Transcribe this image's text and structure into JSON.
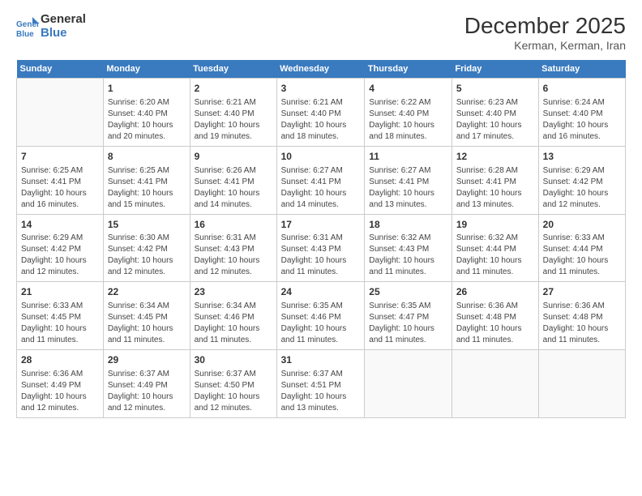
{
  "header": {
    "logo_line1": "General",
    "logo_line2": "Blue",
    "title": "December 2025",
    "subtitle": "Kerman, Kerman, Iran"
  },
  "days_of_week": [
    "Sunday",
    "Monday",
    "Tuesday",
    "Wednesday",
    "Thursday",
    "Friday",
    "Saturday"
  ],
  "weeks": [
    [
      {
        "day": "",
        "info": ""
      },
      {
        "day": "1",
        "info": "Sunrise: 6:20 AM\nSunset: 4:40 PM\nDaylight: 10 hours\nand 20 minutes."
      },
      {
        "day": "2",
        "info": "Sunrise: 6:21 AM\nSunset: 4:40 PM\nDaylight: 10 hours\nand 19 minutes."
      },
      {
        "day": "3",
        "info": "Sunrise: 6:21 AM\nSunset: 4:40 PM\nDaylight: 10 hours\nand 18 minutes."
      },
      {
        "day": "4",
        "info": "Sunrise: 6:22 AM\nSunset: 4:40 PM\nDaylight: 10 hours\nand 18 minutes."
      },
      {
        "day": "5",
        "info": "Sunrise: 6:23 AM\nSunset: 4:40 PM\nDaylight: 10 hours\nand 17 minutes."
      },
      {
        "day": "6",
        "info": "Sunrise: 6:24 AM\nSunset: 4:40 PM\nDaylight: 10 hours\nand 16 minutes."
      }
    ],
    [
      {
        "day": "7",
        "info": "Sunrise: 6:25 AM\nSunset: 4:41 PM\nDaylight: 10 hours\nand 16 minutes."
      },
      {
        "day": "8",
        "info": "Sunrise: 6:25 AM\nSunset: 4:41 PM\nDaylight: 10 hours\nand 15 minutes."
      },
      {
        "day": "9",
        "info": "Sunrise: 6:26 AM\nSunset: 4:41 PM\nDaylight: 10 hours\nand 14 minutes."
      },
      {
        "day": "10",
        "info": "Sunrise: 6:27 AM\nSunset: 4:41 PM\nDaylight: 10 hours\nand 14 minutes."
      },
      {
        "day": "11",
        "info": "Sunrise: 6:27 AM\nSunset: 4:41 PM\nDaylight: 10 hours\nand 13 minutes."
      },
      {
        "day": "12",
        "info": "Sunrise: 6:28 AM\nSunset: 4:41 PM\nDaylight: 10 hours\nand 13 minutes."
      },
      {
        "day": "13",
        "info": "Sunrise: 6:29 AM\nSunset: 4:42 PM\nDaylight: 10 hours\nand 12 minutes."
      }
    ],
    [
      {
        "day": "14",
        "info": "Sunrise: 6:29 AM\nSunset: 4:42 PM\nDaylight: 10 hours\nand 12 minutes."
      },
      {
        "day": "15",
        "info": "Sunrise: 6:30 AM\nSunset: 4:42 PM\nDaylight: 10 hours\nand 12 minutes."
      },
      {
        "day": "16",
        "info": "Sunrise: 6:31 AM\nSunset: 4:43 PM\nDaylight: 10 hours\nand 12 minutes."
      },
      {
        "day": "17",
        "info": "Sunrise: 6:31 AM\nSunset: 4:43 PM\nDaylight: 10 hours\nand 11 minutes."
      },
      {
        "day": "18",
        "info": "Sunrise: 6:32 AM\nSunset: 4:43 PM\nDaylight: 10 hours\nand 11 minutes."
      },
      {
        "day": "19",
        "info": "Sunrise: 6:32 AM\nSunset: 4:44 PM\nDaylight: 10 hours\nand 11 minutes."
      },
      {
        "day": "20",
        "info": "Sunrise: 6:33 AM\nSunset: 4:44 PM\nDaylight: 10 hours\nand 11 minutes."
      }
    ],
    [
      {
        "day": "21",
        "info": "Sunrise: 6:33 AM\nSunset: 4:45 PM\nDaylight: 10 hours\nand 11 minutes."
      },
      {
        "day": "22",
        "info": "Sunrise: 6:34 AM\nSunset: 4:45 PM\nDaylight: 10 hours\nand 11 minutes."
      },
      {
        "day": "23",
        "info": "Sunrise: 6:34 AM\nSunset: 4:46 PM\nDaylight: 10 hours\nand 11 minutes."
      },
      {
        "day": "24",
        "info": "Sunrise: 6:35 AM\nSunset: 4:46 PM\nDaylight: 10 hours\nand 11 minutes."
      },
      {
        "day": "25",
        "info": "Sunrise: 6:35 AM\nSunset: 4:47 PM\nDaylight: 10 hours\nand 11 minutes."
      },
      {
        "day": "26",
        "info": "Sunrise: 6:36 AM\nSunset: 4:48 PM\nDaylight: 10 hours\nand 11 minutes."
      },
      {
        "day": "27",
        "info": "Sunrise: 6:36 AM\nSunset: 4:48 PM\nDaylight: 10 hours\nand 11 minutes."
      }
    ],
    [
      {
        "day": "28",
        "info": "Sunrise: 6:36 AM\nSunset: 4:49 PM\nDaylight: 10 hours\nand 12 minutes."
      },
      {
        "day": "29",
        "info": "Sunrise: 6:37 AM\nSunset: 4:49 PM\nDaylight: 10 hours\nand 12 minutes."
      },
      {
        "day": "30",
        "info": "Sunrise: 6:37 AM\nSunset: 4:50 PM\nDaylight: 10 hours\nand 12 minutes."
      },
      {
        "day": "31",
        "info": "Sunrise: 6:37 AM\nSunset: 4:51 PM\nDaylight: 10 hours\nand 13 minutes."
      },
      {
        "day": "",
        "info": ""
      },
      {
        "day": "",
        "info": ""
      },
      {
        "day": "",
        "info": ""
      }
    ]
  ]
}
